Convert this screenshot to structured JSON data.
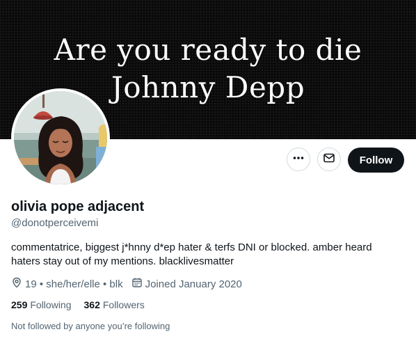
{
  "banner": {
    "line1": "Are you ready to die",
    "line2": "Johnny Depp"
  },
  "profile": {
    "display_name": "olivia pope adjacent",
    "handle": "@donotperceivemi",
    "bio": "commentatrice, biggest j*hnny d*ep hater & terfs DNI or blocked. amber heard haters stay out of my mentions. blacklivesmatter",
    "location": "19 • she/her/elle • blk",
    "joined": "Joined January 2020"
  },
  "actions": {
    "follow_label": "Follow"
  },
  "stats": {
    "following_count": "259",
    "following_label": "Following",
    "followers_count": "362",
    "followers_label": "Followers"
  },
  "footer": {
    "not_followed_text": "Not followed by anyone you’re following"
  },
  "icons": {
    "more": "more-icon",
    "message": "message-icon",
    "location": "location-pin-icon",
    "calendar": "calendar-icon"
  },
  "colors": {
    "text_primary": "#0f1419",
    "text_secondary": "#536471",
    "follow_button": "#0f1419",
    "banner_bg": "#0a0a0a",
    "border": "#cfd9de"
  }
}
